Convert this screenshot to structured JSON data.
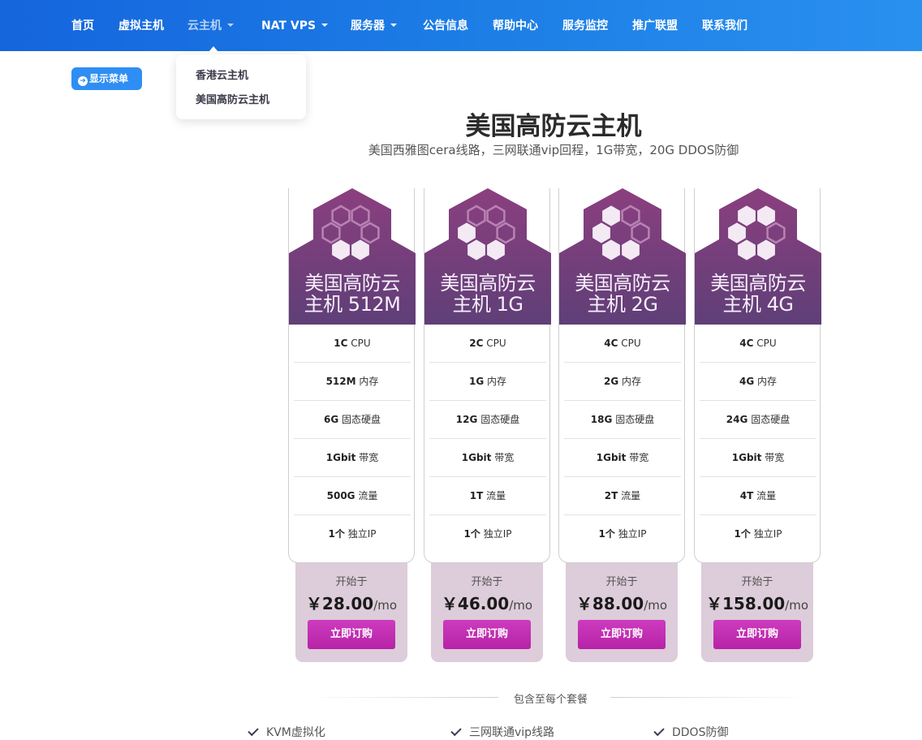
{
  "nav": {
    "items": [
      {
        "label": "首页",
        "dropdown": false
      },
      {
        "label": "虚拟主机",
        "dropdown": false
      },
      {
        "label": "云主机",
        "dropdown": true
      },
      {
        "label": "NAT VPS",
        "dropdown": true
      },
      {
        "label": "服务器",
        "dropdown": true
      },
      {
        "label": "公告信息",
        "dropdown": false
      },
      {
        "label": "帮助中心",
        "dropdown": false
      },
      {
        "label": "服务监控",
        "dropdown": false
      },
      {
        "label": "推广联盟",
        "dropdown": false
      },
      {
        "label": "联系我们",
        "dropdown": false
      }
    ],
    "active_item": "云主机"
  },
  "dropdown": {
    "items": [
      "香港云主机",
      "美国高防云主机"
    ]
  },
  "menu_button": {
    "label": "显示菜单"
  },
  "page": {
    "title": "美国高防云主机",
    "subtitle": "美国西雅图cera线路，三网联通vip回程，1G带宽，20G DDOS防御"
  },
  "plans": [
    {
      "name_line1": "美国高防云",
      "name_line2": "主机 512M",
      "hex_filled": 2,
      "specs": [
        {
          "value": "1C",
          "label": "CPU"
        },
        {
          "value": "512M",
          "label": "内存"
        },
        {
          "value": "6G",
          "label": "固态硬盘"
        },
        {
          "value": "1Gbit",
          "label": "带宽"
        },
        {
          "value": "500G",
          "label": "流量"
        },
        {
          "value": "1个",
          "label": "独立IP"
        }
      ],
      "starts_label": "开始于",
      "price": "￥28.00",
      "period": "/mo",
      "buy_label": "立即订购"
    },
    {
      "name_line1": "美国高防云",
      "name_line2": "主机 1G",
      "hex_filled": 3,
      "specs": [
        {
          "value": "2C",
          "label": "CPU"
        },
        {
          "value": "1G",
          "label": "内存"
        },
        {
          "value": "12G",
          "label": "固态硬盘"
        },
        {
          "value": "1Gbit",
          "label": "带宽"
        },
        {
          "value": "1T",
          "label": "流量"
        },
        {
          "value": "1个",
          "label": "独立IP"
        }
      ],
      "starts_label": "开始于",
      "price": "￥46.00",
      "period": "/mo",
      "buy_label": "立即订购"
    },
    {
      "name_line1": "美国高防云",
      "name_line2": "主机 2G",
      "hex_filled": 4,
      "specs": [
        {
          "value": "4C",
          "label": "CPU"
        },
        {
          "value": "2G",
          "label": "内存"
        },
        {
          "value": "18G",
          "label": "固态硬盘"
        },
        {
          "value": "1Gbit",
          "label": "带宽"
        },
        {
          "value": "2T",
          "label": "流量"
        },
        {
          "value": "1个",
          "label": "独立IP"
        }
      ],
      "starts_label": "开始于",
      "price": "￥88.00",
      "period": "/mo",
      "buy_label": "立即订购"
    },
    {
      "name_line1": "美国高防云",
      "name_line2": "主机 4G",
      "hex_filled": 5,
      "specs": [
        {
          "value": "4C",
          "label": "CPU"
        },
        {
          "value": "4G",
          "label": "内存"
        },
        {
          "value": "24G",
          "label": "固态硬盘"
        },
        {
          "value": "1Gbit",
          "label": "带宽"
        },
        {
          "value": "4T",
          "label": "流量"
        },
        {
          "value": "1个",
          "label": "独立IP"
        }
      ],
      "starts_label": "开始于",
      "price": "￥158.00",
      "period": "/mo",
      "buy_label": "立即订购"
    }
  ],
  "included": {
    "title": "包含至每个套餐",
    "features": [
      "KVM虚拟化",
      "三网联通vip线路",
      "DDOS防御"
    ]
  },
  "colors": {
    "nav_start": "#1565dd",
    "nav_end": "#2a90ef",
    "header_top": "#8b3f7f",
    "header_bottom": "#5f3f77",
    "buy_button": "#c12fb3",
    "price_panel": "#ddccd9"
  }
}
